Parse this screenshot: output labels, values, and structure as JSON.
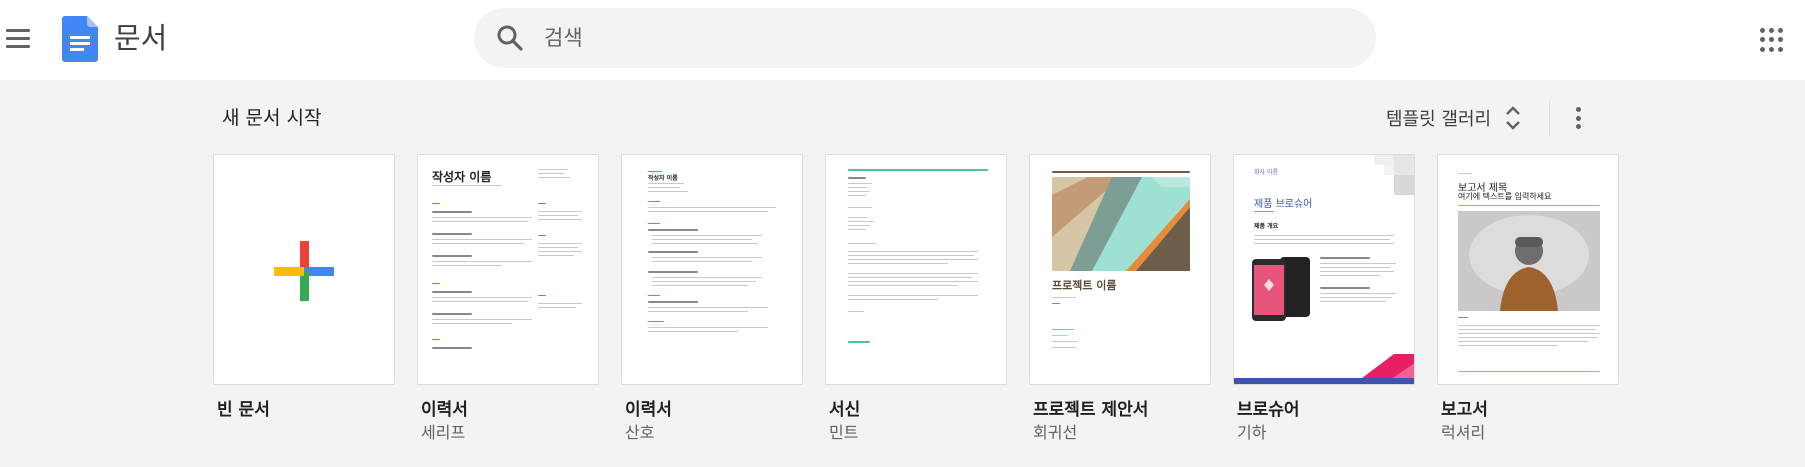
{
  "app": {
    "title": "문서",
    "brand_color": "#4285f4"
  },
  "search": {
    "placeholder": "검색"
  },
  "section": {
    "title": "새 문서 시작",
    "gallery_label": "템플릿 갤러리"
  },
  "icons": {
    "menu": "hamburger-menu-icon",
    "search": "magnifier-icon",
    "apps": "grid-apps-icon",
    "gallery_toggle": "unfold-icon",
    "more": "vertical-dots-icon"
  },
  "templates": [
    {
      "name": "빈 문서",
      "sub": ""
    },
    {
      "name": "이력서",
      "sub": "세리프",
      "thumb": {
        "title": "작성자 이름"
      }
    },
    {
      "name": "이력서",
      "sub": "산호",
      "thumb": {
        "title": "작성자 이름"
      }
    },
    {
      "name": "서신",
      "sub": "민트"
    },
    {
      "name": "프로젝트 제안서",
      "sub": "회귀선",
      "thumb": {
        "title": "프로젝트 이름"
      }
    },
    {
      "name": "브로슈어",
      "sub": "기하",
      "thumb": {
        "company": "회사 이름",
        "title": "제품 브로슈어",
        "section": "제품 개요"
      }
    },
    {
      "name": "보고서",
      "sub": "럭셔리",
      "thumb": {
        "title": "보고서 제목",
        "subtitle": "여기에 텍스트를 입력하세요"
      }
    }
  ]
}
